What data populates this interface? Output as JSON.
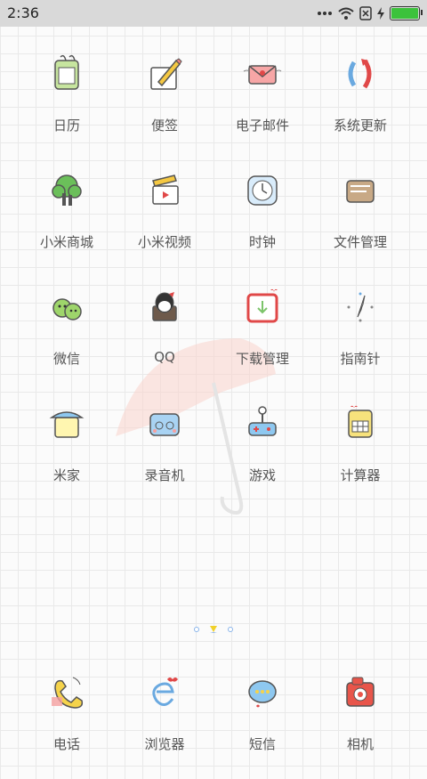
{
  "status_bar": {
    "time": "2:36",
    "icons": [
      "dots-icon",
      "wifi-icon",
      "no-sim-icon",
      "charging-icon",
      "battery-icon"
    ],
    "battery_color": "#3cc23c"
  },
  "apps": [
    {
      "label": "日历",
      "icon": "calendar-icon"
    },
    {
      "label": "便签",
      "icon": "notes-icon"
    },
    {
      "label": "电子邮件",
      "icon": "email-icon"
    },
    {
      "label": "系统更新",
      "icon": "update-icon"
    },
    {
      "label": "小米商城",
      "icon": "store-icon"
    },
    {
      "label": "小米视频",
      "icon": "video-icon"
    },
    {
      "label": "时钟",
      "icon": "clock-icon"
    },
    {
      "label": "文件管理",
      "icon": "folder-icon"
    },
    {
      "label": "微信",
      "icon": "wechat-icon"
    },
    {
      "label": "QQ",
      "icon": "qq-icon"
    },
    {
      "label": "下载管理",
      "icon": "download-icon"
    },
    {
      "label": "指南针",
      "icon": "compass-icon"
    },
    {
      "label": "米家",
      "icon": "mihome-icon"
    },
    {
      "label": "录音机",
      "icon": "recorder-icon"
    },
    {
      "label": "游戏",
      "icon": "game-icon"
    },
    {
      "label": "计算器",
      "icon": "calculator-icon"
    }
  ],
  "page_indicator": {
    "count": 3,
    "active_index": 1
  },
  "dock": [
    {
      "label": "电话",
      "icon": "phone-icon"
    },
    {
      "label": "浏览器",
      "icon": "browser-icon"
    },
    {
      "label": "短信",
      "icon": "messages-icon"
    },
    {
      "label": "相机",
      "icon": "camera-icon"
    }
  ]
}
